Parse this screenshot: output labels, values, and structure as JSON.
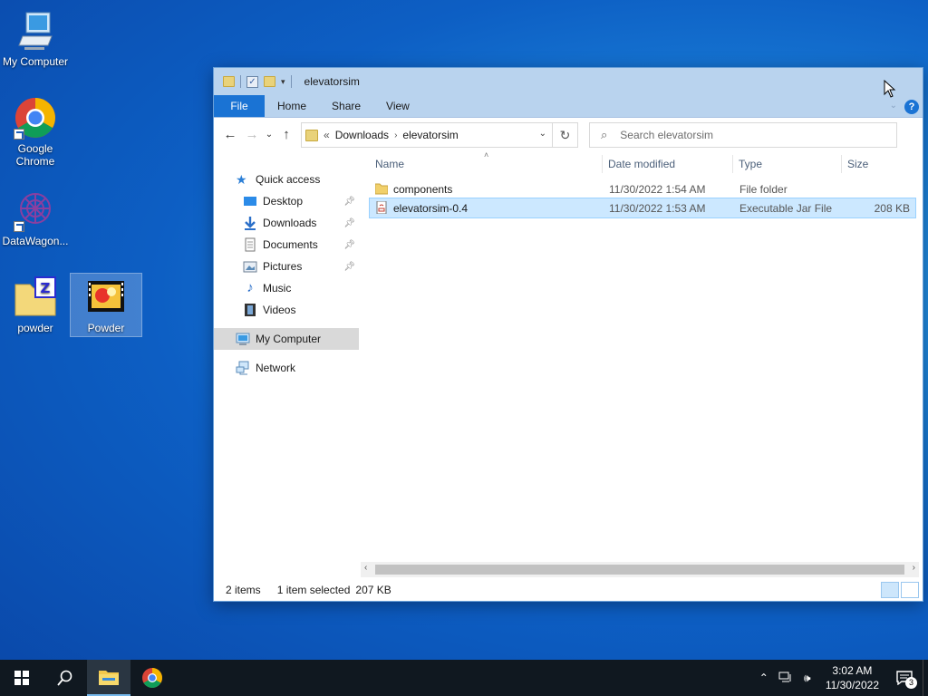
{
  "desktop": {
    "icons": [
      {
        "label": "My Computer",
        "icon": "computer-icon"
      },
      {
        "label": "Google Chrome",
        "icon": "chrome-icon"
      },
      {
        "label": "DataWagon...",
        "icon": "datawagon-icon"
      },
      {
        "label": "powder",
        "icon": "zip-folder-icon"
      },
      {
        "label": "Powder",
        "icon": "video-file-icon"
      }
    ]
  },
  "explorer": {
    "title": "elevatorsim",
    "ribbon_tabs": [
      "File",
      "Home",
      "Share",
      "View"
    ],
    "help_label": "?",
    "address": {
      "prefix": "«",
      "crumbs": [
        "Downloads",
        "elevatorsim"
      ]
    },
    "search_placeholder": "Search elevatorsim",
    "nav_pane": {
      "quick_access": "Quick access",
      "pinned": [
        "Desktop",
        "Downloads",
        "Documents",
        "Pictures"
      ],
      "unpinned": [
        "Music",
        "Videos"
      ],
      "my_computer": "My Computer",
      "network": "Network"
    },
    "columns": {
      "name": "Name",
      "date": "Date modified",
      "type": "Type",
      "size": "Size"
    },
    "files": [
      {
        "name": "components",
        "date": "11/30/2022 1:54 AM",
        "type": "File folder",
        "size": "",
        "icon": "folder-icon",
        "selected": false
      },
      {
        "name": "elevatorsim-0.4",
        "date": "11/30/2022 1:53 AM",
        "type": "Executable Jar File",
        "size": "208 KB",
        "icon": "jar-file-icon",
        "selected": true
      }
    ],
    "status": {
      "items": "2 items",
      "selected": "1 item selected",
      "size": "207 KB"
    }
  },
  "taskbar": {
    "clock_time": "3:02 AM",
    "clock_date": "11/30/2022",
    "notification_count": "3"
  },
  "colors": {
    "accent": "#1a73d4",
    "selection": "#cce8ff",
    "taskbar": "#101820"
  }
}
